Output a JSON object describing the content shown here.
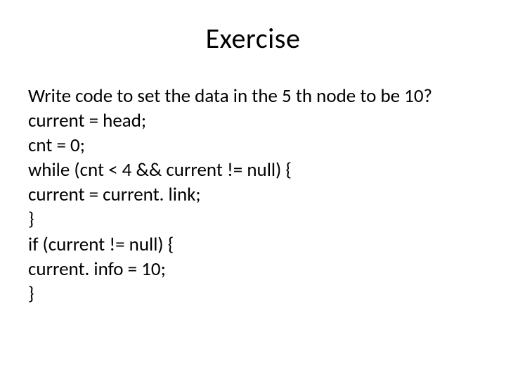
{
  "title": "Exercise",
  "lines": [
    "Write code to set the data in the 5 th node to be 10?",
    "current = head;",
    "cnt = 0;",
    "while (cnt < 4 && current != null) {",
    "current = current. link;",
    "}",
    "if (current != null) {",
    "current. info = 10;",
    "}"
  ]
}
